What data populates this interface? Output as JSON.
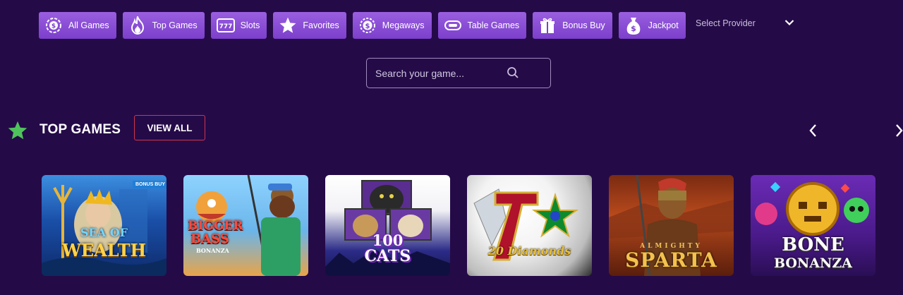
{
  "filters": [
    {
      "label": "All Games",
      "icon": "chip-icon"
    },
    {
      "label": "Top Games",
      "icon": "flame-icon"
    },
    {
      "label": "Slots",
      "icon": "slot-777-icon"
    },
    {
      "label": "Favorites",
      "icon": "star-icon"
    },
    {
      "label": "Megaways",
      "icon": "dollar-coin-icon"
    },
    {
      "label": "Table Games",
      "icon": "table-card-icon"
    },
    {
      "label": "Bonus Buy",
      "icon": "gift-icon"
    },
    {
      "label": "Jackpot",
      "icon": "money-bag-icon"
    }
  ],
  "provider": {
    "label": "Select Provider",
    "icon": "chevron-down-icon"
  },
  "search": {
    "placeholder": "Search your game...",
    "icon": "search-icon"
  },
  "section": {
    "title": "TOP GAMES",
    "view_all": "VIEW ALL",
    "icon": "star-icon",
    "prev_icon": "chevron-left-icon",
    "next_icon": "chevron-right-icon"
  },
  "games": [
    {
      "line1": "SEA OF",
      "line2": "WEALTH",
      "badge": "BONUS BUY"
    },
    {
      "line1": "BIGGER",
      "line2": "BASS",
      "line3": "BONANZA"
    },
    {
      "line1": "100",
      "line2": "CATS"
    },
    {
      "line1": "20",
      "line2": "Diamonds"
    },
    {
      "line1": "ALMIGHTY",
      "line2": "SPARTA"
    },
    {
      "line1": "BONE",
      "line2": "BONANZA"
    }
  ],
  "colors": {
    "background": "#250a48",
    "filter_button": "#8a4fd8",
    "view_all_border": "#d0364c",
    "star_accent": "#4fc35b"
  }
}
